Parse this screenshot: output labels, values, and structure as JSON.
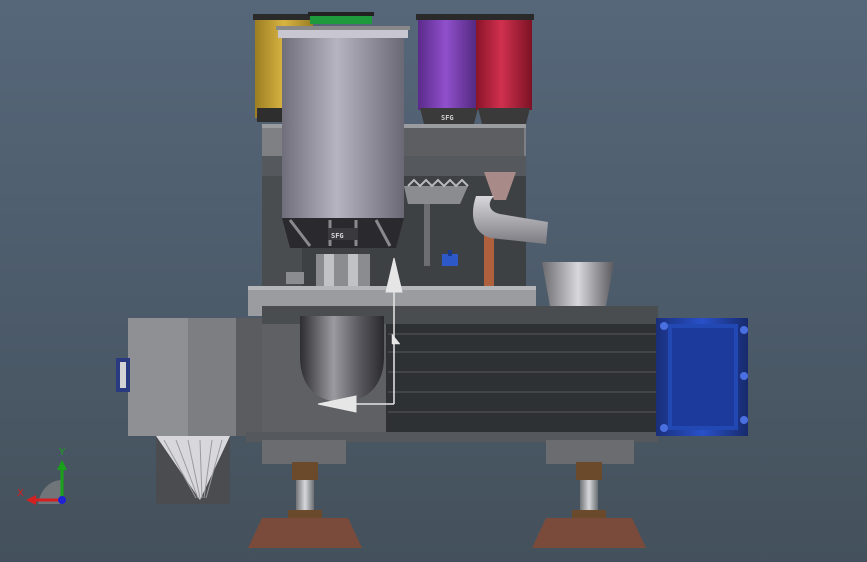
{
  "viewport": {
    "background_top": "#56677a",
    "background_bottom": "#44515c"
  },
  "triad": {
    "x_label": "X",
    "y_label": "Y",
    "x_color": "#d42020",
    "y_color": "#19a219",
    "z_color": "#2020d4"
  },
  "canisters": [
    {
      "id": "yellow",
      "color": "#c9a634"
    },
    {
      "id": "green",
      "color": "#1e9a3c"
    },
    {
      "id": "purple",
      "color": "#7a3cb4"
    },
    {
      "id": "red",
      "color": "#c01f3c"
    },
    {
      "id": "grey",
      "color": "#8c8a96",
      "label": "SFG"
    }
  ],
  "small_canister_label": "SFG",
  "colors": {
    "motor_blue": "#1e3fa8",
    "housing_dark": "#3c3f42",
    "housing_mid": "#5a5d60",
    "feet_brown": "#7a4a3a",
    "pipe_copper": "#b0603c",
    "indicator_arrow": "#e6e6e6"
  }
}
